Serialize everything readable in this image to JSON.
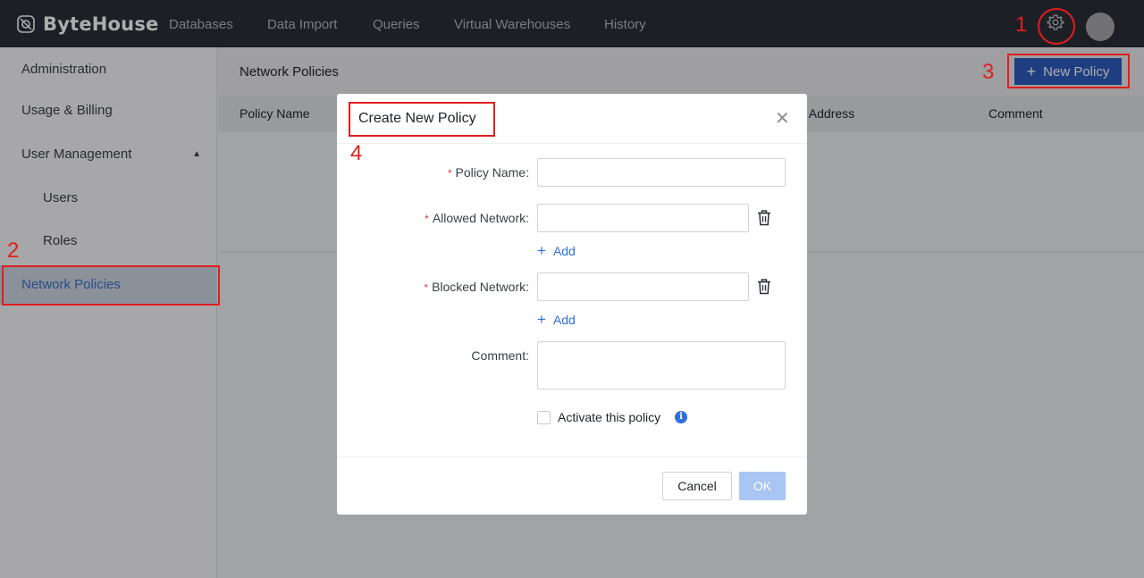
{
  "app": {
    "name": "ByteHouse"
  },
  "nav": {
    "items": [
      {
        "label": "Databases"
      },
      {
        "label": "Data Import"
      },
      {
        "label": "Queries"
      },
      {
        "label": "Virtual Warehouses"
      },
      {
        "label": "History"
      }
    ]
  },
  "sidebar": {
    "items": [
      {
        "label": "Administration"
      },
      {
        "label": "Usage & Billing"
      },
      {
        "label": "User Management"
      },
      {
        "label": "Users"
      },
      {
        "label": "Roles"
      },
      {
        "label": "Network Policies"
      }
    ]
  },
  "main": {
    "title": "Network Policies",
    "new_policy_label": "New Policy",
    "columns": [
      "Policy Name",
      "rk Address",
      "Comment"
    ]
  },
  "dialog": {
    "title": "Create New Policy",
    "fields": {
      "policy_name": {
        "label": "Policy Name",
        "value": ""
      },
      "allowed_network": {
        "label": "Allowed Network",
        "value": ""
      },
      "blocked_network": {
        "label": "Blocked Network",
        "value": ""
      },
      "comment": {
        "label": "Comment",
        "value": ""
      }
    },
    "add_label": "Add",
    "activate_label": "Activate this policy",
    "cancel_label": "Cancel",
    "ok_label": "OK"
  },
  "annotations": {
    "step1": "1",
    "step2": "2",
    "step3": "3",
    "step4": "4"
  },
  "colors": {
    "topbar": "#2b2f38",
    "accent": "#2e5cbf",
    "link": "#2e6fdc",
    "annotation": "#e01e1e",
    "required": "#e03a3a"
  }
}
